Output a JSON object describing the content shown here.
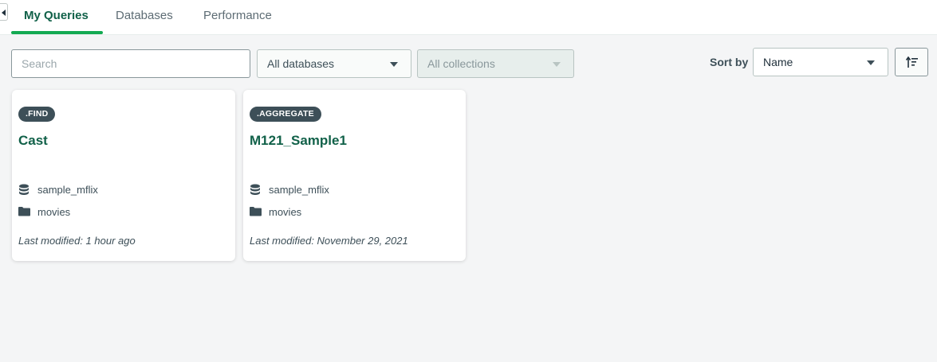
{
  "tabs": [
    {
      "label": "My Queries",
      "active": true
    },
    {
      "label": "Databases",
      "active": false
    },
    {
      "label": "Performance",
      "active": false
    }
  ],
  "toolbar": {
    "search_placeholder": "Search",
    "database_filter": "All databases",
    "collection_filter": "All collections",
    "sort_label": "Sort by",
    "sort_value": "Name",
    "sort_direction_icon": "sort-ascending-icon"
  },
  "cards": [
    {
      "type": ".FIND",
      "title": "Cast",
      "database": "sample_mflix",
      "collection": "movies",
      "modified": "Last modified: 1 hour ago"
    },
    {
      "type": ".AGGREGATE",
      "title": "M121_Sample1",
      "database": "sample_mflix",
      "collection": "movies",
      "modified": "Last modified: November 29, 2021"
    }
  ],
  "colors": {
    "accent": "#13aa52",
    "title_green": "#116149",
    "badge_bg": "#3d4f58",
    "page_bg": "#f4f5f6"
  }
}
